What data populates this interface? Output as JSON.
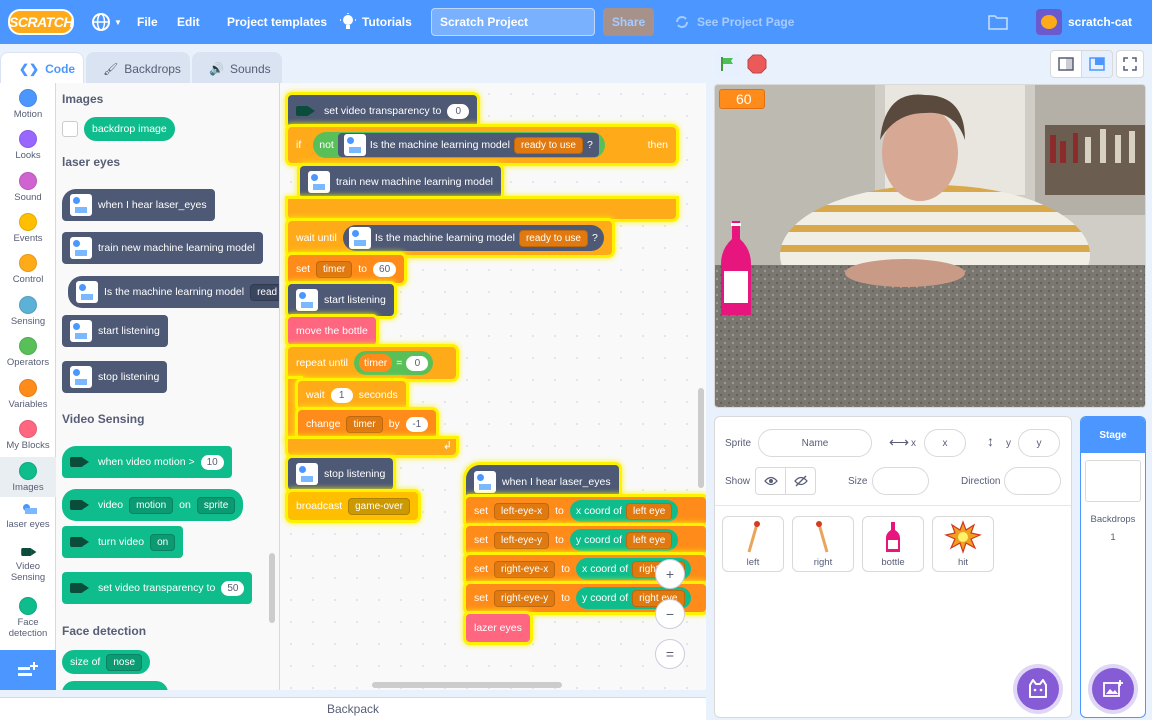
{
  "menu": {
    "logo": "SCRATCH",
    "file": "File",
    "edit": "Edit",
    "templates": "Project templates",
    "tutorials": "Tutorials",
    "project_title": "Scratch Project",
    "share": "Share",
    "see_project": "See Project Page",
    "username": "scratch-cat"
  },
  "tabs": {
    "code": "Code",
    "backdrops": "Backdrops",
    "sounds": "Sounds"
  },
  "categories": [
    {
      "label": "Motion",
      "color": "#4c97ff"
    },
    {
      "label": "Looks",
      "color": "#9966ff"
    },
    {
      "label": "Sound",
      "color": "#cf63cf"
    },
    {
      "label": "Events",
      "color": "#ffbf00"
    },
    {
      "label": "Control",
      "color": "#ffab19"
    },
    {
      "label": "Sensing",
      "color": "#5cb1d6"
    },
    {
      "label": "Operators",
      "color": "#59c059"
    },
    {
      "label": "Variables",
      "color": "#ff8c1a"
    },
    {
      "label": "My Blocks",
      "color": "#ff6680"
    },
    {
      "label": "Images",
      "color": "#0fbd8c"
    },
    {
      "label": "laser eyes",
      "color": "#4d5975"
    },
    {
      "label": "Video Sensing",
      "color": "#0fbd8c"
    },
    {
      "label": "Face detection",
      "color": "#0fbd8c"
    }
  ],
  "palette": {
    "images_header": "Images",
    "backdrop_image": "backdrop image",
    "laser_header": "laser eyes",
    "when_hear": "when I hear laser_eyes",
    "train": "train new machine learning model",
    "is_model": "Is the machine learning model",
    "is_model_drop": "read",
    "start_listening": "start listening",
    "stop_listening": "stop listening",
    "video_header": "Video Sensing",
    "when_motion": "when video motion >",
    "when_motion_val": "10",
    "video": "video",
    "video_drop": "motion",
    "on": "on",
    "sprite_drop": "sprite",
    "turn_video": "turn video",
    "turn_video_drop": "on",
    "set_transparency": "set video transparency to",
    "transparency_val": "50",
    "face_header": "Face detection",
    "size_of": "size of",
    "nose_drop": "nose"
  },
  "script": {
    "set_transparency": "set video transparency to",
    "transparency_val": "0",
    "if": "if",
    "not": "not",
    "is_model": "Is the machine learning model",
    "ready_drop": "ready to use",
    "question": "?",
    "then": "then",
    "train": "train new machine learning model",
    "wait_until": "wait until",
    "set": "set",
    "timer_drop": "timer",
    "to": "to",
    "timer_val": "60",
    "start_listening": "start listening",
    "move_bottle": "move the bottle",
    "repeat_until": "repeat until",
    "timer_reporter": "timer",
    "eq": "=",
    "zero": "0",
    "wait": "wait",
    "one": "1",
    "seconds": "seconds",
    "change": "change",
    "by": "by",
    "minus_one": "-1",
    "stop_listening": "stop listening",
    "broadcast": "broadcast",
    "gameover_drop": "game-over",
    "when_hear": "when I hear laser_eyes",
    "left_eye_x": "left-eye-x",
    "left_eye_y": "left-eye-y",
    "right_eye_x": "right-eye-x",
    "right_eye_y": "right-eye-y",
    "x_coord_of": "x coord of",
    "y_coord_of": "y coord of",
    "left_eye": "left eye",
    "right_eye_a": "right eye",
    "right_eye_b": "right eye",
    "lazer_eyes": "lazer eyes"
  },
  "zoom": {
    "in": "+",
    "out": "−",
    "reset": "="
  },
  "backpack": "Backpack",
  "stage": {
    "timer_monitor": "60"
  },
  "sprite_info": {
    "sprite_label": "Sprite",
    "name_placeholder": "Name",
    "x_label": "x",
    "x_placeholder": "x",
    "y_label": "y",
    "y_placeholder": "y",
    "show_label": "Show",
    "size_label": "Size",
    "direction_label": "Direction"
  },
  "sprites": [
    {
      "name": "left",
      "icon": "matchstick-icon"
    },
    {
      "name": "right",
      "icon": "matchstick-icon"
    },
    {
      "name": "bottle",
      "icon": "bottle-icon"
    },
    {
      "name": "hit",
      "icon": "explosion-icon"
    }
  ],
  "stage_panel": {
    "title": "Stage",
    "backdrops_label": "Backdrops",
    "backdrops_count": "1"
  }
}
